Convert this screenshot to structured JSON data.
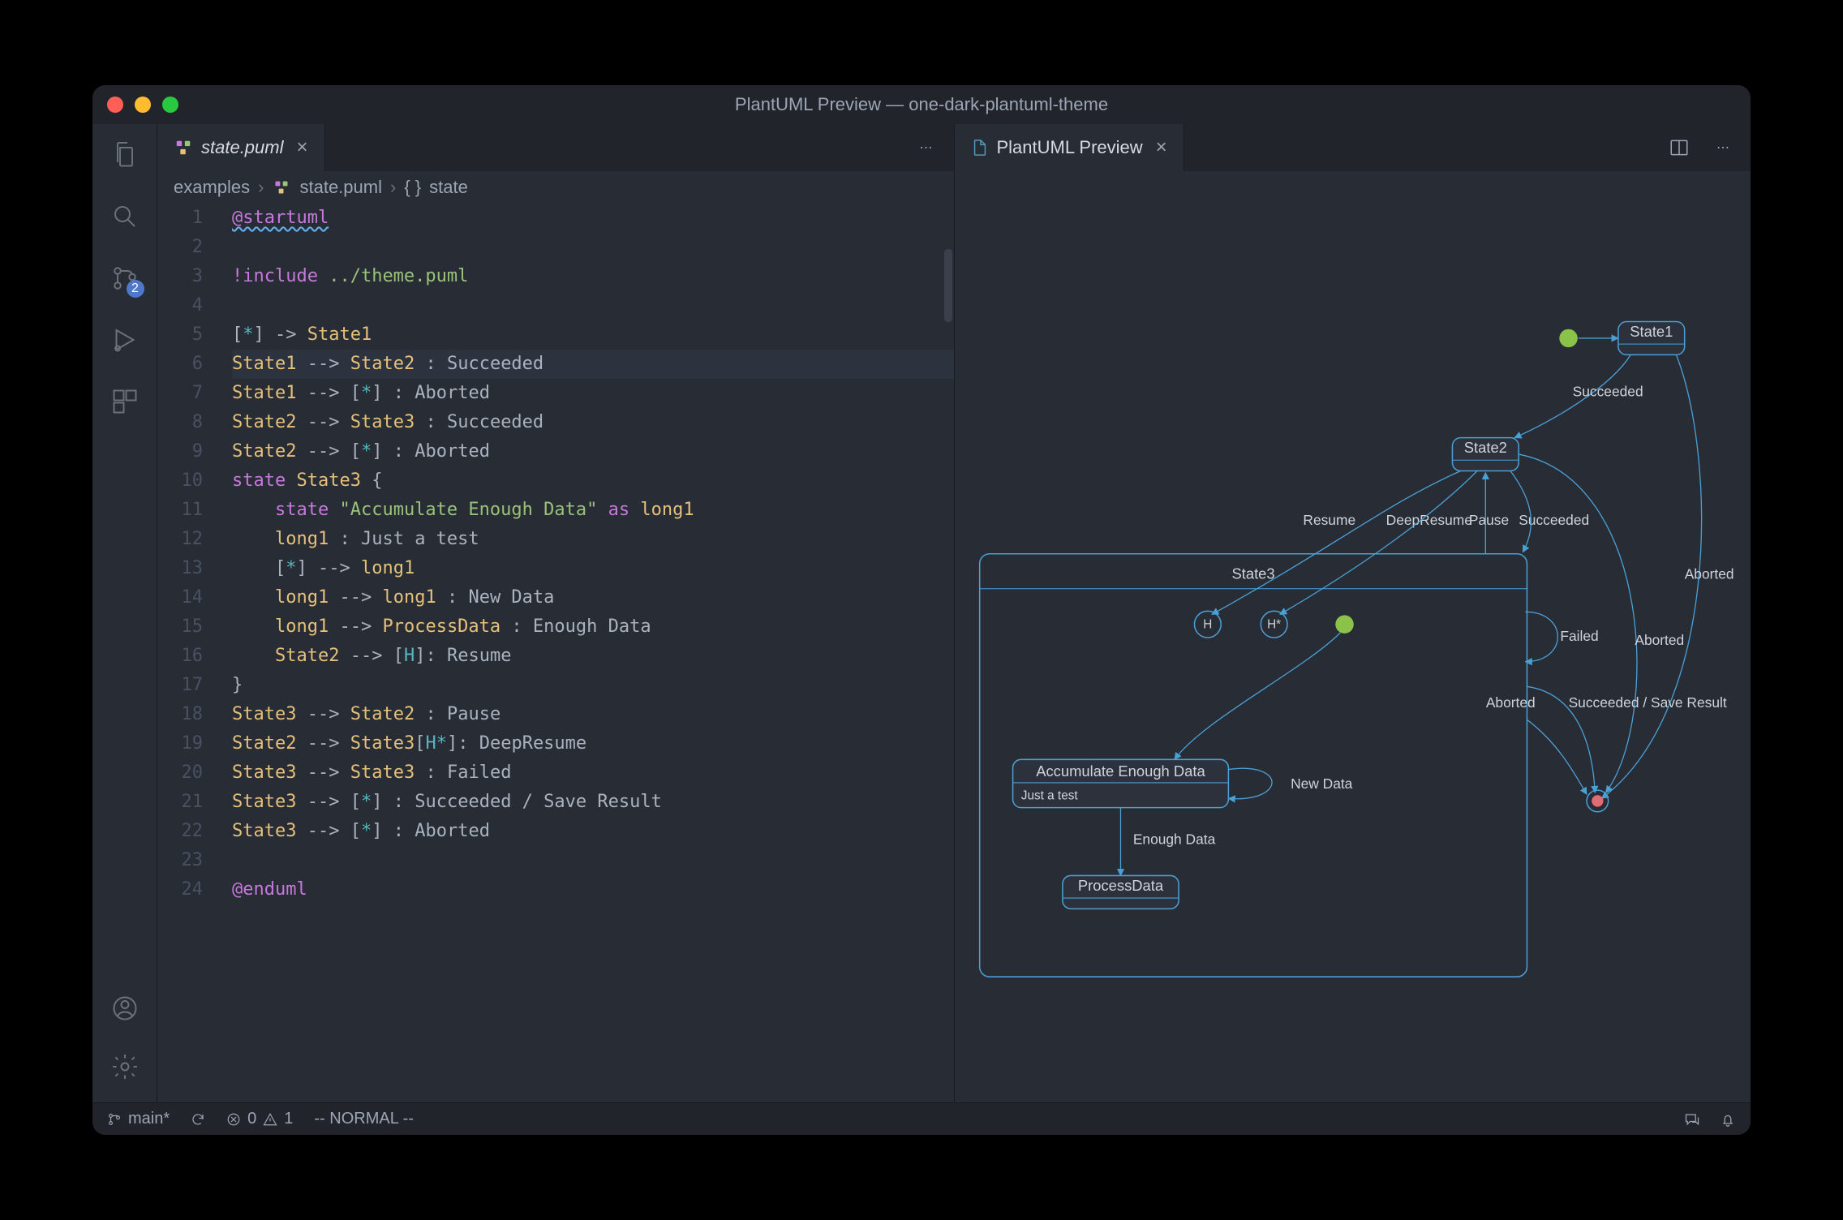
{
  "window": {
    "title": "PlantUML Preview — one-dark-plantuml-theme"
  },
  "activity": {
    "scm_badge": "2"
  },
  "editor": {
    "tab_label": "state.puml",
    "breadcrumbs": {
      "folder": "examples",
      "file": "state.puml",
      "symbol": "state"
    },
    "lines": [
      "@startuml",
      "",
      "!include ../theme.puml",
      "",
      "[*] -> State1",
      "State1 --> State2 : Succeeded",
      "State1 --> [*] : Aborted",
      "State2 --> State3 : Succeeded",
      "State2 --> [*] : Aborted",
      "state State3 {",
      "    state \"Accumulate Enough Data\" as long1",
      "    long1 : Just a test",
      "    [*] --> long1",
      "    long1 --> long1 : New Data",
      "    long1 --> ProcessData : Enough Data",
      "    State2 --> [H]: Resume",
      "}",
      "State3 --> State2 : Pause",
      "State2 --> State3[H*]: DeepResume",
      "State3 --> State3 : Failed",
      "State3 --> [*] : Succeeded / Save Result",
      "State3 --> [*] : Aborted",
      "",
      "@enduml"
    ],
    "active_line": 6
  },
  "preview": {
    "tab_label": "PlantUML Preview",
    "states": {
      "State1": "State1",
      "State2": "State2",
      "State3": "State3",
      "long1_title": "Accumulate Enough Data",
      "long1_sub": "Just a test",
      "ProcessData": "ProcessData"
    },
    "labels": {
      "Succeeded": "Succeeded",
      "Aborted": "Aborted",
      "Resume": "Resume",
      "DeepResume": "DeepResume",
      "Pause": "Pause",
      "Failed": "Failed",
      "SaveResult": "Succeeded / Save Result",
      "NewData": "New Data",
      "EnoughData": "Enough Data",
      "H": "H",
      "Hstar": "H*"
    }
  },
  "status": {
    "branch": "main*",
    "errors": "0",
    "warnings": "1",
    "mode": "-- NORMAL --"
  }
}
